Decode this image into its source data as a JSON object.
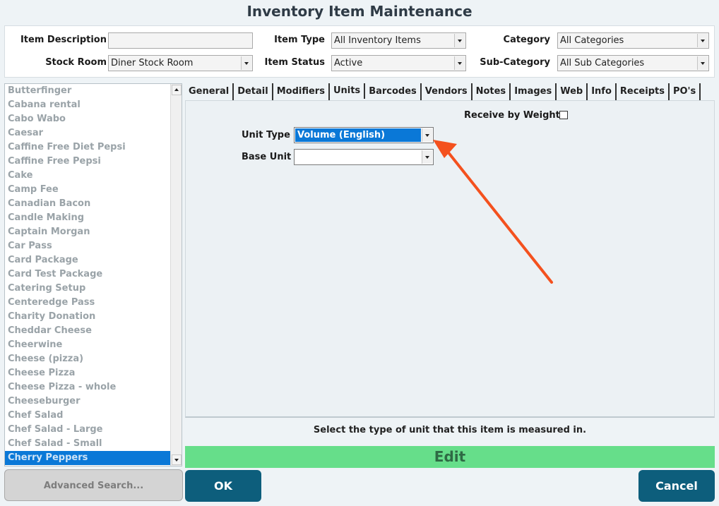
{
  "title": "Inventory Item Maintenance",
  "filters": {
    "item_description_label": "Item Description",
    "item_description_value": "",
    "stock_room_label": "Stock Room",
    "stock_room_value": "Diner Stock Room",
    "item_type_label": "Item Type",
    "item_type_value": "All Inventory Items",
    "item_status_label": "Item Status",
    "item_status_value": "Active",
    "category_label": "Category",
    "category_value": "All Categories",
    "sub_category_label": "Sub-Category",
    "sub_category_value": "All Sub Categories"
  },
  "items": [
    "Butterfinger",
    "Cabana rental",
    "Cabo Wabo",
    "Caesar",
    "Caffine Free Diet Pepsi",
    "Caffine Free Pepsi",
    "Cake",
    "Camp Fee",
    "Canadian Bacon",
    "Candle Making",
    "Captain Morgan",
    "Car Pass",
    "Card Package",
    "Card Test Package",
    "Catering Setup",
    "Centeredge Pass",
    "Charity Donation",
    "Cheddar Cheese",
    "Cheerwine",
    "Cheese (pizza)",
    "Cheese Pizza",
    "Cheese Pizza - whole",
    "Cheeseburger",
    "Chef Salad",
    "Chef Salad - Large",
    "Chef Salad - Small",
    "Cherry Peppers"
  ],
  "selected_item": "Cherry Peppers",
  "tabs": [
    "General",
    "Detail",
    "Modifiers",
    "Units",
    "Barcodes",
    "Vendors",
    "Notes",
    "Images",
    "Web",
    "Info",
    "Receipts",
    "PO's"
  ],
  "active_tab": "Units",
  "units": {
    "receive_by_weight_label": "Receive by Weight",
    "receive_by_weight_checked": false,
    "unit_type_label": "Unit Type",
    "unit_type_value": "Volume (English)",
    "base_unit_label": "Base Unit",
    "base_unit_value": ""
  },
  "hint": "Select the type of unit that this item is measured in.",
  "edit_label": "Edit",
  "buttons": {
    "advanced_search": "Advanced Search...",
    "ok": "OK",
    "cancel": "Cancel"
  },
  "colors": {
    "accent": "#0a78d7",
    "button": "#0d5e7c",
    "edit_bar": "#66de8a",
    "annotation_arrow": "#f4511e"
  }
}
